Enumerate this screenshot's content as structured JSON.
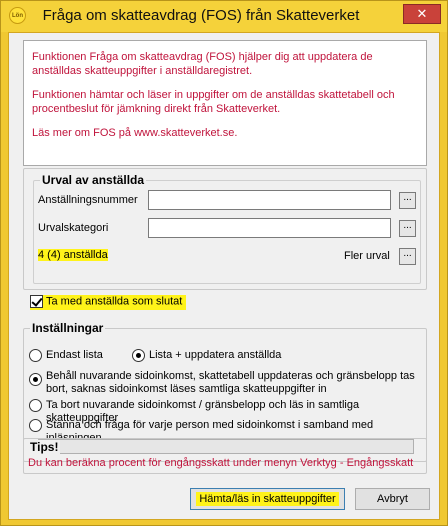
{
  "window": {
    "title": "Fråga om skatteavdrag (FOS) från Skatteverket",
    "app_icon_text": "Lön",
    "close_glyph": "✕"
  },
  "info": {
    "paragraph1": "Funktionen Fråga om skatteavdrag (FOS) hjälper dig att uppdatera de anställdas skatteuppgifter i anställdaregistret.",
    "paragraph2": "Funktionen hämtar och läser in uppgifter om de anställdas skattetabell och procentbeslut för jämkning direkt från Skatteverket.",
    "paragraph3": "Läs mer om FOS på www.skatteverket.se."
  },
  "urval": {
    "legend": "Urval av anställda",
    "anstallningsnummer_label": "Anställningsnummer",
    "anstallningsnummer_value": "",
    "urvalskategori_label": "Urvalskategori",
    "urvalskategori_value": "",
    "count_text": "4 (4) anställda",
    "more_selection_label": "Fler urval",
    "dots_label": "..."
  },
  "include_terminated": {
    "label": "Ta med anställda som slutat",
    "checked": true
  },
  "installningar": {
    "legend": "Inställningar",
    "mode_list": "Endast lista",
    "mode_update": "Lista + uppdatera anställda",
    "option1": "Behåll nuvarande sidoinkomst, skattetabell uppdateras och gränsbelopp tas bort, saknas sidoinkomst läses samtliga skatteuppgifter in",
    "option2": "Ta bort nuvarande sidoinkomst / gränsbelopp och läs in samtliga skatteuppgifter",
    "option3": "Stanna och fråga för varje person med sidoinkomst i samband med inläsningen",
    "selected_mode": "mode_update",
    "selected_option": "option1",
    "progress": 0
  },
  "tips": {
    "legend": "Tips!",
    "text": "Du kan beräkna procent för engångsskatt under menyn Verktyg - Engångsskatt"
  },
  "buttons": {
    "fetch": "Hämta/läs in skatteuppgifter",
    "cancel": "Avbryt"
  },
  "colors": {
    "accent_red": "#c0143c",
    "highlight_yellow": "#fff31a",
    "title_yellow": "#f5d23a"
  }
}
